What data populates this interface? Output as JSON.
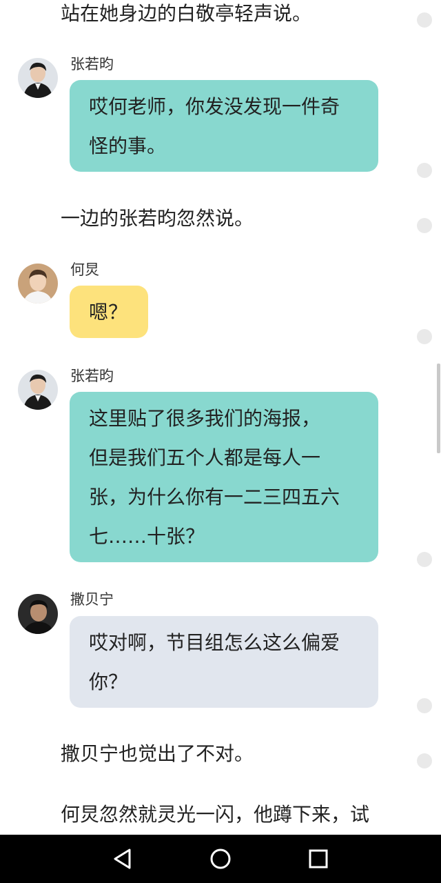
{
  "narration": {
    "line1": "站在她身边的白敬亭轻声说。",
    "line2": "一边的张若昀忽然说。",
    "line3": "撒贝宁也觉出了不对。",
    "line4": "何炅忽然就灵光一闪，他蹲下来，试"
  },
  "messages": [
    {
      "speaker": "张若昀",
      "text": "哎何老师，你发没发现一件奇\n怪的事。",
      "bubble_color": "#88d8cf"
    },
    {
      "speaker": "何炅",
      "text": "嗯？",
      "bubble_color": "#fde27c"
    },
    {
      "speaker": "张若昀",
      "text": "这里贴了很多我们的海报，\n但是我们五个人都是每人一\n张，为什么你有一二三四五六\n七……十张？",
      "bubble_color": "#88d8cf"
    },
    {
      "speaker": "撒贝宁",
      "text": "哎对啊，节目组怎么这么偏爱\n你？",
      "bubble_color": "#e1e6ee"
    }
  ],
  "navbar": {
    "back_icon": "triangle-back-icon",
    "home_icon": "circle-home-icon",
    "recents_icon": "square-recents-icon"
  }
}
